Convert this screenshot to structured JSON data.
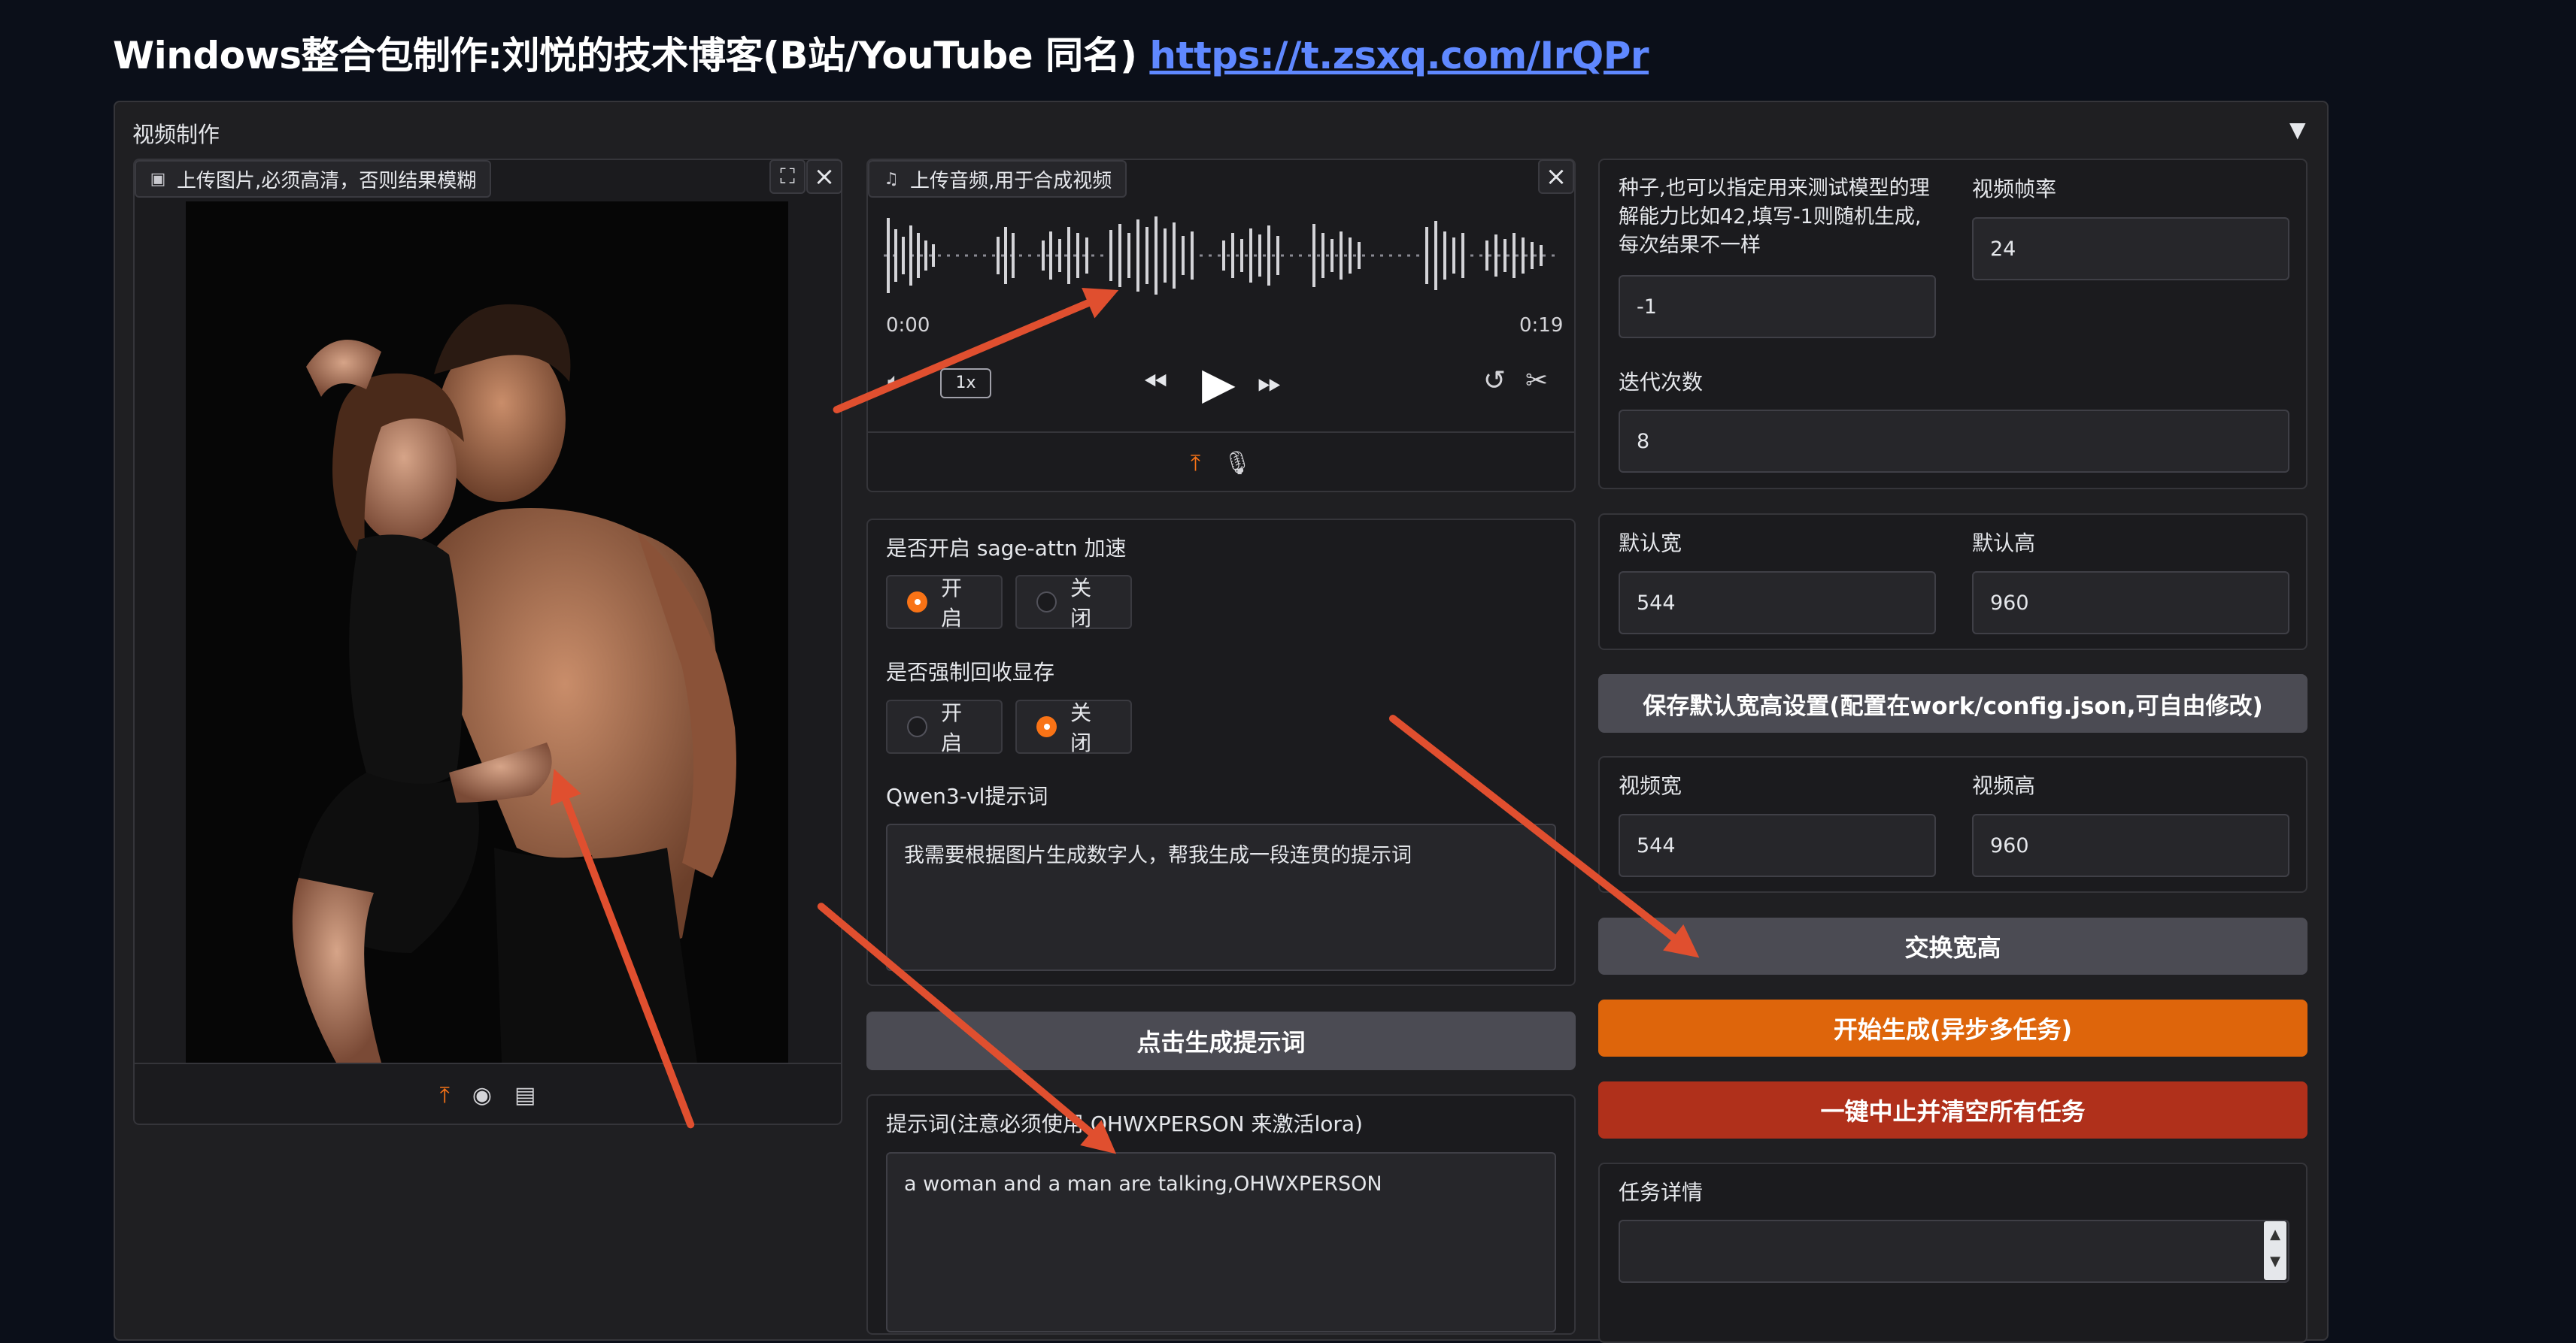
{
  "header": {
    "title": "Windows整合包制作:刘悦的技术博客(B站/YouTube 同名)",
    "link": "https://t.zsxq.com/IrQPr"
  },
  "accordion": {
    "title": "视频制作",
    "caret": "▼"
  },
  "image_upload": {
    "label": "上传图片,必须高清，否则结果模糊"
  },
  "audio_upload": {
    "label": "上传音频,用于合成视频",
    "time_start": "0:00",
    "time_end": "0:19",
    "speed": "1x"
  },
  "sage": {
    "label": "是否开启 sage-attn 加速",
    "options": [
      "开启",
      "关闭"
    ],
    "selected": "开启"
  },
  "recycle": {
    "label": "是否强制回收显存",
    "options": [
      "开启",
      "关闭"
    ],
    "selected": "关闭"
  },
  "qwen": {
    "label": "Qwen3-vl提示词",
    "value": "我需要根据图片生成数字人，帮我生成一段连贯的提示词"
  },
  "gen_prompt_button": "点击生成提示词",
  "prompt": {
    "label": "提示词(注意必须使用 OHWXPERSON 来激活lora)",
    "value": "a woman and a man are talking,OHWXPERSON"
  },
  "seed": {
    "label": "种子,也可以指定用来测试模型的理解能力比如42,填写-1则随机生成,每次结果不一样",
    "value": "-1"
  },
  "fps": {
    "label": "视频帧率",
    "value": "24"
  },
  "steps": {
    "label": "迭代次数",
    "value": "8"
  },
  "default_w": {
    "label": "默认宽",
    "value": "544"
  },
  "default_h": {
    "label": "默认高",
    "value": "960"
  },
  "save_default_button": "保存默认宽高设置(配置在work/config.json,可自由修改)",
  "video_w": {
    "label": "视频宽",
    "value": "544"
  },
  "video_h": {
    "label": "视频高",
    "value": "960"
  },
  "swap_button": "交换宽高",
  "start_button": "开始生成(异步多任务)",
  "stop_button": "一键中止并清空所有任务",
  "task_detail": {
    "label": "任务详情",
    "value": ""
  },
  "colors": {
    "accent": "#de650b",
    "danger": "#b0301b",
    "link": "#5f88ff",
    "annotation_arrow": "#e04f2f"
  }
}
